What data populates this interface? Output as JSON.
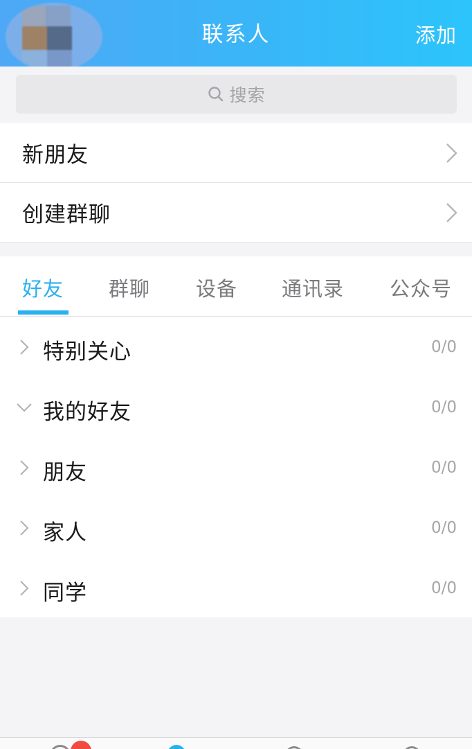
{
  "header": {
    "title": "联系人",
    "add_label": "添加",
    "gradient_start": "#4ea8f5",
    "gradient_end": "#2cc4fb"
  },
  "search": {
    "placeholder": "搜索",
    "icon": "search-icon"
  },
  "entries": [
    {
      "label": "新朋友",
      "icon": "chevron-right-icon"
    },
    {
      "label": "创建群聊",
      "icon": "chevron-right-icon"
    }
  ],
  "tabs": [
    {
      "label": "好友",
      "active": true
    },
    {
      "label": "群聊",
      "active": false
    },
    {
      "label": "设备",
      "active": false
    },
    {
      "label": "通讯录",
      "active": false
    },
    {
      "label": "公众号",
      "active": false
    }
  ],
  "groups": [
    {
      "name": "特别关心",
      "count": "0/0",
      "expanded": false
    },
    {
      "name": "我的好友",
      "count": "0/0",
      "expanded": true
    },
    {
      "name": "朋友",
      "count": "0/0",
      "expanded": false
    },
    {
      "name": "家人",
      "count": "0/0",
      "expanded": false
    },
    {
      "name": "同学",
      "count": "0/0",
      "expanded": false
    }
  ],
  "colors": {
    "accent": "#2ab0ee",
    "badge": "#f04b3f"
  }
}
